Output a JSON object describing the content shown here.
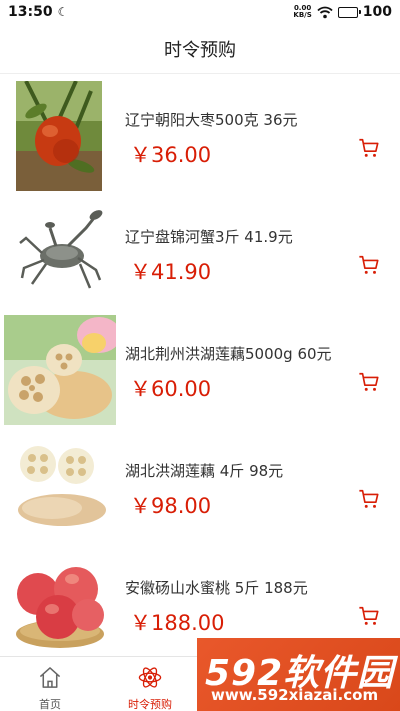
{
  "status_bar": {
    "time": "13:50",
    "net_speed_top": "0.00",
    "net_speed_bottom": "KB/S",
    "battery": "100"
  },
  "header": {
    "title": "时令预购"
  },
  "products": [
    {
      "name": "辽宁朝阳大枣500克 36元",
      "price": "￥36.00",
      "image": "jujube"
    },
    {
      "name": "辽宁盘锦河蟹3斤 41.9元",
      "price": "￥41.90",
      "image": "crab"
    },
    {
      "name": "湖北荆州洪湖莲藕5000g 60元",
      "price": "￥60.00",
      "image": "lotus-root-with-flower"
    },
    {
      "name": "湖北洪湖莲藕 4斤 98元",
      "price": "￥98.00",
      "image": "lotus-root"
    },
    {
      "name": "安徽砀山水蜜桃 5斤 188元",
      "price": "￥188.00",
      "image": "peaches"
    }
  ],
  "tabbar": {
    "tabs": [
      {
        "label": "首页",
        "icon": "home-icon"
      },
      {
        "label": "时令预购",
        "icon": "atom-icon",
        "active": true
      },
      {
        "label": "",
        "icon": "cart-icon"
      },
      {
        "label": "",
        "icon": "user-icon"
      }
    ]
  },
  "watermark": {
    "brand": "592软件园",
    "url": "www.592xiazai.com"
  },
  "colors": {
    "accent": "#d81e06",
    "watermark": "#e9582b"
  }
}
